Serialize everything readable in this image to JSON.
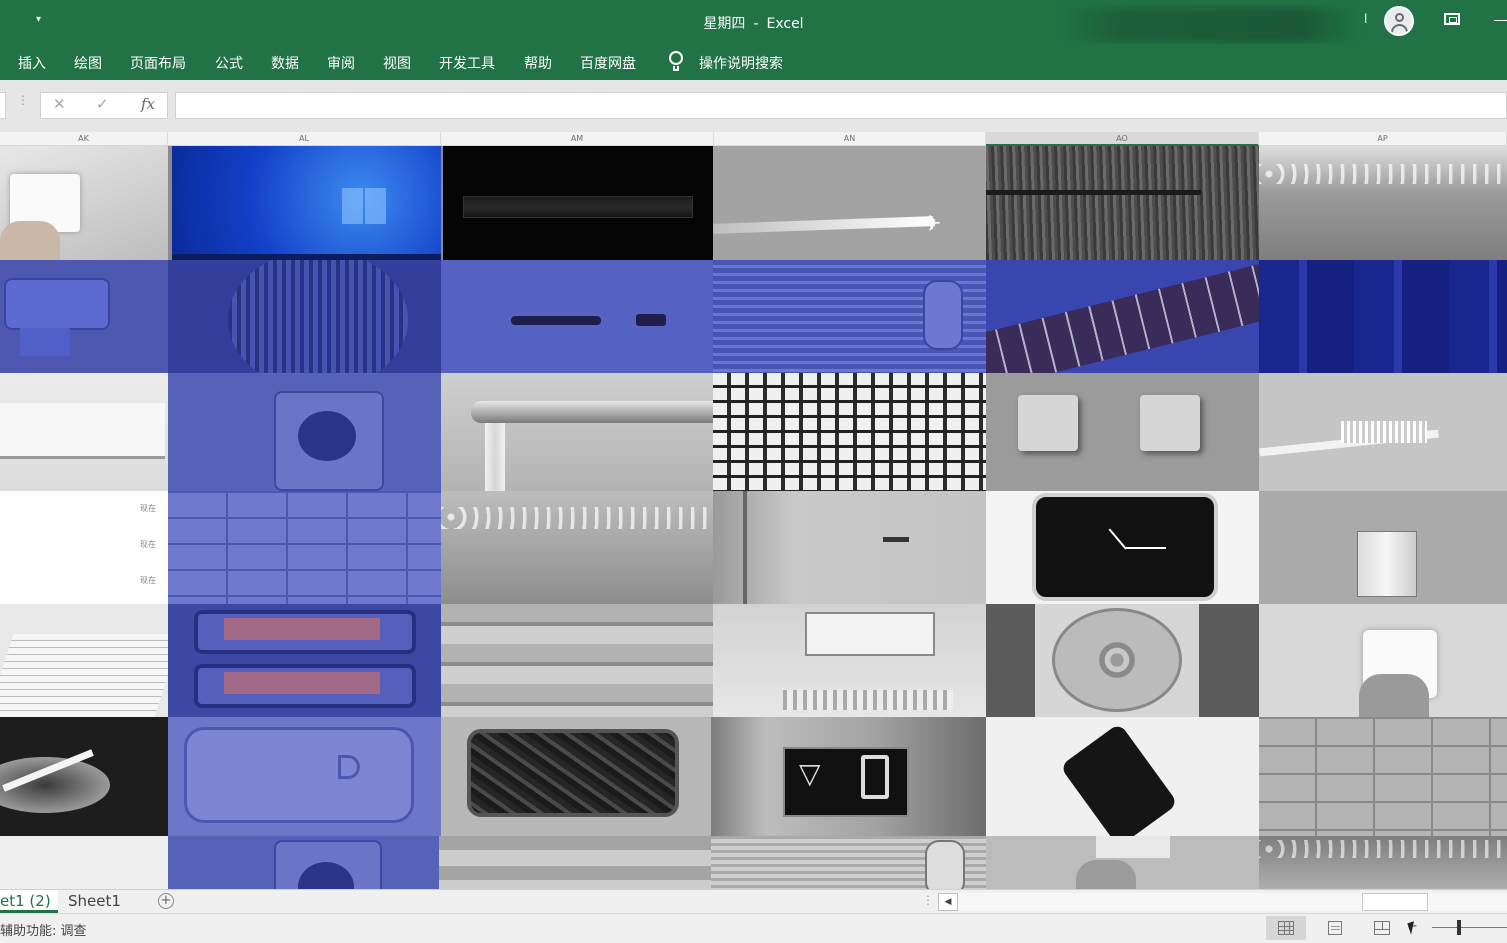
{
  "window": {
    "title_doc": "星期四",
    "title_sep": "-",
    "title_app": "Excel",
    "user_name_fragment": "l"
  },
  "ribbon": {
    "tabs": [
      "插入",
      "绘图",
      "页面布局",
      "公式",
      "数据",
      "审阅",
      "视图",
      "开发工具",
      "帮助",
      "百度网盘"
    ],
    "tell_me": "操作说明搜索"
  },
  "formula_bar": {
    "dots": "⋮",
    "cancel": "✕",
    "enter": "✓",
    "fx": "fx",
    "value": ""
  },
  "columns": [
    "AK",
    "AL",
    "AM",
    "AN",
    "AO",
    "AP"
  ],
  "selected_column": "AO",
  "grid_tiles": [
    [
      "toilet-paper-roll",
      "windows-desktop",
      "dark-light-tube",
      "airplane-contrail",
      "hair-pin",
      "water-splash"
    ],
    [
      "photo-printer",
      "fan-grill",
      "marker-pen",
      "window-blinds",
      "guitar-fretboard",
      "blue-stripes"
    ],
    [
      "air-conditioner",
      "wall-socket",
      "faucet-running",
      "keyboard-keys",
      "light-switches",
      "toothbrush"
    ],
    [
      "text-screen",
      "stone-tiles",
      "water-splash",
      "door",
      "wall-clock",
      "glass-of-water"
    ],
    [
      "open-book",
      "toaster",
      "shelf",
      "refrigerator",
      "pizza",
      "toilet-paper-roll"
    ],
    [
      "ashtray-cigarette",
      "scale",
      "trash-bag-bin",
      "elevator-display",
      "phone-charging",
      "stone-floor"
    ],
    [
      "blank",
      "wall-socket",
      "shelf",
      "window-blinds",
      "hand",
      "water-splash"
    ]
  ],
  "tile_texts": {
    "screen_words": [
      "现在",
      "现在",
      "现在"
    ]
  },
  "sheets": [
    {
      "label": "et1 (2)",
      "active": true
    },
    {
      "label": "Sheet1",
      "active": false
    }
  ],
  "add_sheet": "+",
  "scroll_left_arrow": "◀",
  "status": {
    "accessibility": "辅助功能: 调查",
    "zoom_minus": "-"
  },
  "colors": {
    "excel_green": "#217346",
    "blue_tint": "#4a56b5"
  }
}
